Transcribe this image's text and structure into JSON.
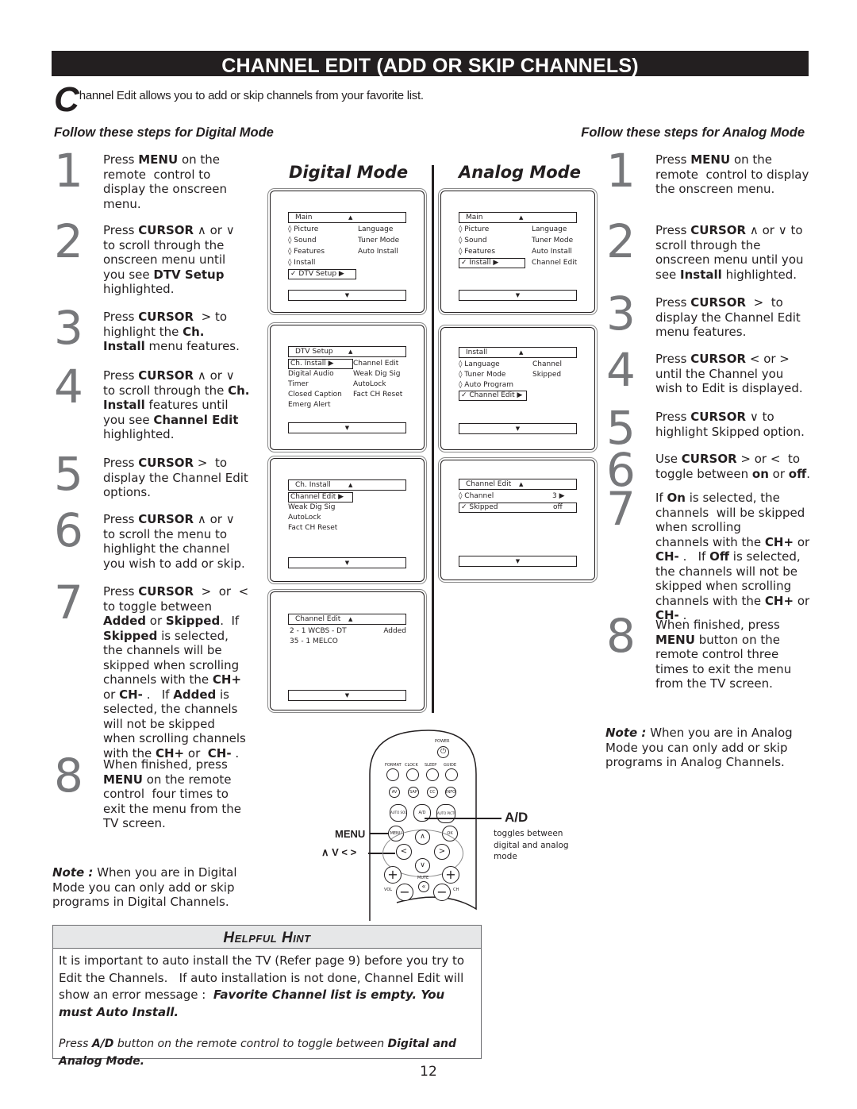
{
  "title": "CHANNEL EDIT (ADD OR SKIP CHANNELS)",
  "intro": {
    "dropcap": "C",
    "rest": "hannel Edit allows you to add or skip channels from your favorite list."
  },
  "follow_digital": "Follow these steps for Digital Mode",
  "follow_analog": "Follow these steps for Analog Mode",
  "digital_steps": [
    {
      "num": "1",
      "html": "Press <b>MENU</b> on the remote&nbsp; control to display the onscreen menu."
    },
    {
      "num": "2",
      "html": "Press <b>CURSOR</b> &#8743; or &#8744; to scroll through the onscreen menu until you see <b>DTV Setup</b> highlighted."
    },
    {
      "num": "3",
      "html": "Press <b>CURSOR</b> &nbsp;&gt; to highlight the <b>Ch. Install</b> menu features."
    },
    {
      "num": "4",
      "html": "Press <b>CURSOR</b> &#8743; or &#8744; to scroll through the <b>Ch. Install</b> features until you see <b>Channel Edit</b> highlighted."
    },
    {
      "num": "5",
      "html": "Press <b>CURSOR</b> &gt;&nbsp; to display the Channel Edit options."
    },
    {
      "num": "6",
      "html": "Press <b>CURSOR</b> &#8743; or &#8744; to scroll the menu to highlight the channel you wish to add or skip."
    },
    {
      "num": "7",
      "html": "Press <b>CURSOR</b> &nbsp;&gt; &nbsp;or &nbsp;&lt; to toggle between <b>Added</b> or <b>Skipped</b>. &nbsp;If <b>Skipped</b> is selected,&nbsp; the channels will be skipped when scrolling channels with the <b>CH+</b> or <b>CH-</b> . &nbsp;&nbsp;If <b>Added</b> is selected, the channels will not be skipped when scrolling channels with the <b>CH+</b> or&nbsp; <b>CH-</b> ."
    },
    {
      "num": "8",
      "html": "When finished, press <b>MENU</b> on the remote control&nbsp; four times to exit the menu from the TV screen."
    }
  ],
  "analog_steps": [
    {
      "num": "1",
      "html": "Press <b>MENU</b> on the remote&nbsp; control to display the onscreen menu."
    },
    {
      "num": "2",
      "html": "Press <b>CURSOR</b> &#8743; or &#8744; to scroll through the onscreen menu until you see <b>Install</b> highlighted."
    },
    {
      "num": "3",
      "html": "Press <b>CURSOR</b> &nbsp;&gt;&nbsp; to display the Channel Edit menu features."
    },
    {
      "num": "4",
      "html": "Press <b>CURSOR</b> &lt; or &gt; until the Channel you wish to Edit is displayed."
    },
    {
      "num": "5",
      "html": "Press <b>CURSOR</b> &#8744; to highlight Skipped option."
    },
    {
      "num": "6",
      "html": "Use <b>CURSOR</b> &gt; or &lt;&nbsp; to toggle between <b>on</b> or <b>off</b>."
    },
    {
      "num": "7",
      "html": "If <b>On</b> is selected, the channels&nbsp; will be skipped when scrolling &nbsp;&nbsp;&nbsp;&nbsp;&nbsp; channels with the <b>CH+</b> or <b>CH-</b> . &nbsp;&nbsp;If <b>Off</b> is selected, the channels will not be skipped when scrolling channels with the <b>CH+</b> or <b>CH-</b> ."
    },
    {
      "num": "8",
      "html": "When finished, press <b>MENU</b> button on the remote control three times to exit the menu from the TV screen."
    }
  ],
  "digital_mode_heading": "Digital Mode",
  "analog_mode_heading": "Analog Mode",
  "digital_screens": [
    {
      "header": "Main",
      "left": [
        {
          "icon": "diamond",
          "label": "Picture"
        },
        {
          "icon": "diamond",
          "label": "Sound"
        },
        {
          "icon": "diamond",
          "label": "Features"
        },
        {
          "icon": "diamond",
          "label": "Install"
        },
        {
          "icon": "check",
          "label": "DTV Setup",
          "selected": true
        }
      ],
      "right": [
        "Language",
        "Tuner Mode",
        "Auto Install"
      ]
    },
    {
      "header": "DTV Setup",
      "left": [
        {
          "label": "Ch. Install",
          "selected": true
        },
        {
          "label": "Digital Audio"
        },
        {
          "label": "Timer"
        },
        {
          "label": "Closed Caption"
        },
        {
          "label": "Emerg Alert"
        }
      ],
      "right": [
        "Channel Edit",
        "Weak Dig Sig",
        "AutoLock",
        "Fact CH Reset"
      ]
    },
    {
      "header": "Ch. Install",
      "left": [
        {
          "label": "Channel Edit",
          "selected": true
        },
        {
          "label": "Weak Dig Sig"
        },
        {
          "label": "AutoLock"
        },
        {
          "label": "Fact CH Reset"
        }
      ],
      "right": []
    },
    {
      "header": "Channel Edit",
      "channels": [
        {
          "label": "2  -  1 WCBS - DT",
          "status": "Added"
        },
        {
          "label": "35 -  1 MELCO",
          "status": ""
        }
      ]
    }
  ],
  "analog_screens": [
    {
      "header": "Main",
      "left": [
        {
          "icon": "diamond",
          "label": "Picture"
        },
        {
          "icon": "diamond",
          "label": "Sound"
        },
        {
          "icon": "diamond",
          "label": "Features"
        },
        {
          "icon": "check",
          "label": "Install",
          "selected": true
        }
      ],
      "right": [
        "Language",
        "Tuner Mode",
        "Auto Install",
        "Channel Edit"
      ]
    },
    {
      "header": "Install",
      "left": [
        {
          "icon": "diamond",
          "label": "Language"
        },
        {
          "icon": "diamond",
          "label": "Tuner Mode"
        },
        {
          "icon": "diamond",
          "label": "Auto Program"
        },
        {
          "icon": "check",
          "label": "Channel Edit",
          "selected": true
        }
      ],
      "right": [
        "Channel",
        "Skipped"
      ]
    },
    {
      "header": "Channel Edit",
      "items": [
        {
          "icon": "diamond",
          "label": "Channel",
          "value": "3",
          "arrow": true
        },
        {
          "icon": "check",
          "label": "Skipped",
          "value": "off",
          "selected": true
        }
      ]
    }
  ],
  "remote": {
    "power": "POWER",
    "row1": [
      "FORMAT",
      "CLOCK",
      "SLEEP",
      "GUIDE"
    ],
    "row2": [
      "AV",
      "SAP",
      "CC",
      "INFO"
    ],
    "row3": [
      "AUTO SOUND",
      "A/D",
      "AUTO PICTURE"
    ],
    "menu": "MENU",
    "ok": "OK",
    "mute": "MUTE",
    "vol": "VOL",
    "ch": "CH",
    "menu_callout": "MENU",
    "cursor_callout": "∧  V < >",
    "ad_callout": "A/D",
    "ad_desc": "toggles between digital and analog mode"
  },
  "note_digital": {
    "label": "Note :",
    "text": " When you are in Digital Mode you can only add or skip programs in Digital Channels."
  },
  "note_analog": {
    "label": "Note :",
    "text": " When you are in Analog Mode you can only add or skip programs in Analog Channels."
  },
  "hint": {
    "title": "Helpful Hint",
    "body": "It is important to auto install the TV (Refer page 9) before you try to Edit the Channels.   If auto installation is not done, Channel Edit will show an error message :  ",
    "error": "Favorite Channel list is empty. You must Auto Install.",
    "note_pre": "Press ",
    "note_btn": "A/D",
    "note_mid": " button on the remote control to toggle between ",
    "note_end": "Digital and Analog Mode."
  },
  "page_number": "12"
}
